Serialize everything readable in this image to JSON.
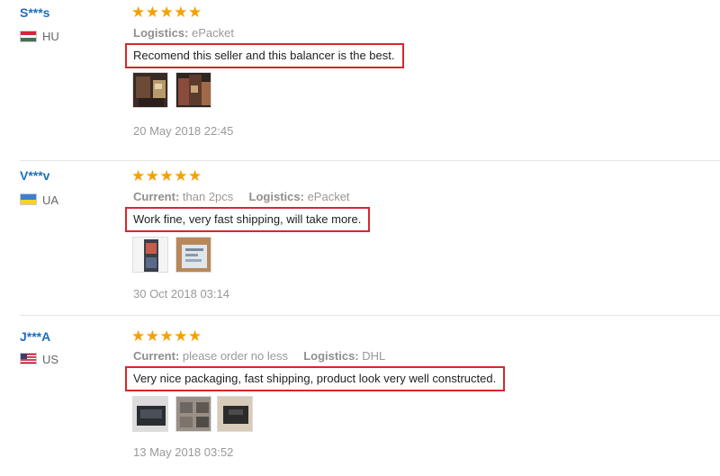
{
  "reviews": [
    {
      "user": "S***s",
      "country": "HU",
      "rating": "★★★★★",
      "attr1_label": "Logistics:",
      "attr1_value": "ePacket",
      "comment": "Recomend this seller and this balancer is the best.",
      "date": "20 May 2018 22:45"
    },
    {
      "user": "V***v",
      "country": "UA",
      "rating": "★★★★★",
      "attr1_label": "Current:",
      "attr1_value": "than 2pcs",
      "attr2_label": "Logistics:",
      "attr2_value": "ePacket",
      "comment": "Work fine, very fast shipping, will take more.",
      "date": "30 Oct 2018 03:14"
    },
    {
      "user": "J***A",
      "country": "US",
      "rating": "★★★★★",
      "attr1_label": "Current:",
      "attr1_value": "please order no less",
      "attr2_label": "Logistics:",
      "attr2_value": "DHL",
      "comment": "Very nice packaging, fast shipping, product look very well constructed.",
      "date": "13 May 2018 03:52"
    }
  ],
  "colors": {
    "username": "#1b6fc2",
    "star": "#f5a000",
    "highlight_border": "#d9262c",
    "meta_text": "#999999"
  }
}
